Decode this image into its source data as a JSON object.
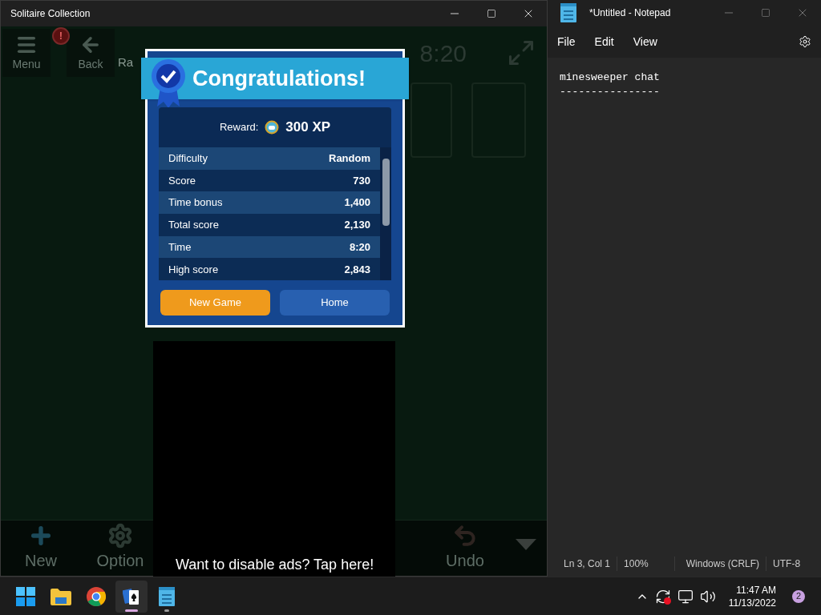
{
  "game_window": {
    "title": "Solitaire Collection",
    "top_bar": {
      "menu_label": "Menu",
      "alert_mark": "!",
      "back_label": "Back",
      "mode_label": "Ra",
      "time": "8:20"
    },
    "bottom_bar": [
      {
        "kind": "new",
        "label": "New"
      },
      {
        "kind": "options",
        "label": "Option"
      },
      {
        "kind": "undo",
        "label": "Undo"
      }
    ],
    "dialog": {
      "title": "Congratulations!",
      "reward_label": "Reward:",
      "reward_value": "300 XP",
      "rows": [
        {
          "label": "Difficulty",
          "value": "Random"
        },
        {
          "label": "Score",
          "value": "730"
        },
        {
          "label": "Time bonus",
          "value": "1,400"
        },
        {
          "label": "Total score",
          "value": "2,130"
        },
        {
          "label": "Time",
          "value": "8:20"
        },
        {
          "label": "High score",
          "value": "2,843"
        }
      ],
      "buttons": [
        {
          "kind": "primary",
          "label": "New Game"
        },
        {
          "kind": "secondary",
          "label": "Home"
        }
      ]
    },
    "ad_banner": {
      "text": "Want to disable ads? Tap here!"
    }
  },
  "notepad": {
    "title": "*Untitled - Notepad",
    "menus": [
      "File",
      "Edit",
      "View"
    ],
    "lines": [
      "minesweeper chat",
      "----------------"
    ],
    "status_bar": [
      "Ln 3, Col 1",
      "100%",
      "Windows (CRLF)",
      "UTF-8"
    ]
  },
  "taskbar": {
    "apps": [
      {
        "kind": "start",
        "selected": false
      },
      {
        "kind": "explorer",
        "selected": false
      },
      {
        "kind": "chrome",
        "selected": false
      },
      {
        "kind": "solitaire",
        "selected": true
      },
      {
        "kind": "notepad",
        "selected": false
      }
    ],
    "time": "11:47 AM",
    "date": "11/13/2022",
    "notification_count": "2"
  }
}
